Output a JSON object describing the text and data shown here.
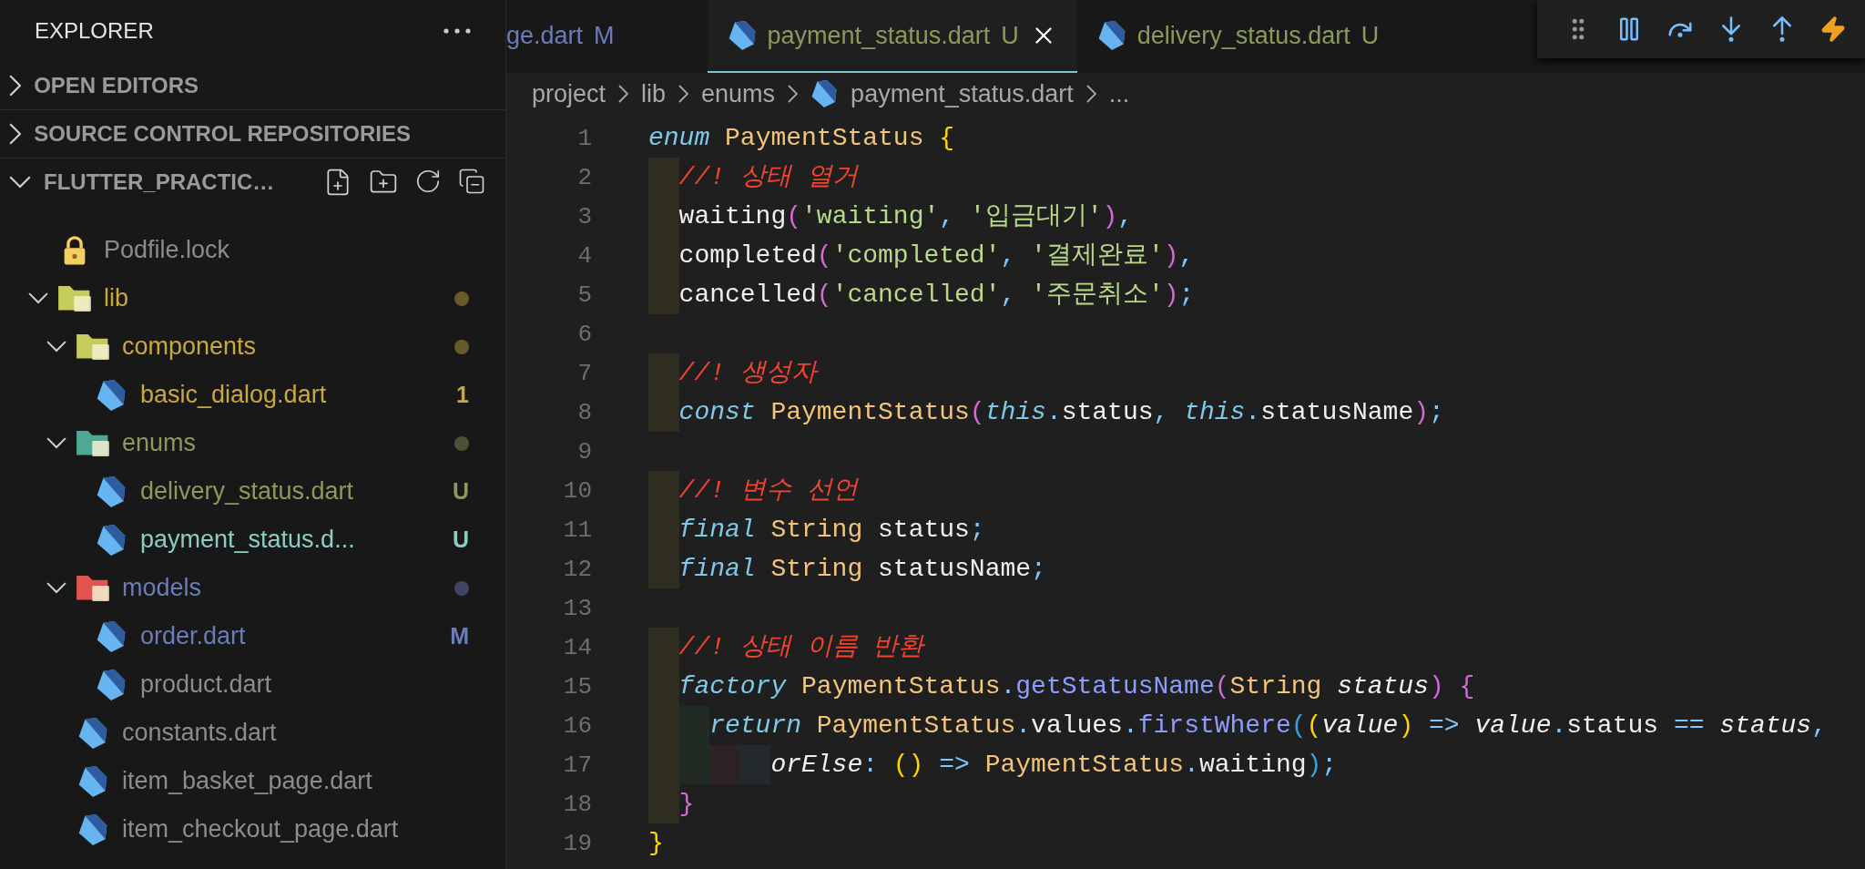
{
  "sidebar": {
    "title": "EXPLORER",
    "sections": [
      {
        "label": "OPEN EDITORS",
        "expanded": false
      },
      {
        "label": "SOURCE CONTROL REPOSITORIES",
        "expanded": false
      },
      {
        "label": "FLUTTER_PRACTIC…",
        "expanded": true,
        "tree": [
          {
            "label": "Podfile.lock",
            "kind": "lock",
            "color": "#8c8c8c"
          },
          {
            "label": "lib",
            "kind": "folder",
            "expanded": true,
            "color": "#c9a93b",
            "icon": {
              "color": "#c5cc5c"
            },
            "dot": true,
            "children": [
              {
                "label": "components",
                "kind": "folder",
                "expanded": true,
                "color": "#c9a93b",
                "icon": {
                  "color": "#c5cc5c"
                },
                "dot": true,
                "children": [
                  {
                    "label": "basic_dialog.dart",
                    "kind": "dart",
                    "color": "#c9a93b",
                    "badge": "1"
                  }
                ]
              },
              {
                "label": "enums",
                "kind": "folder",
                "expanded": true,
                "color": "#8a9a5b",
                "icon": {
                  "color": "#4fa894"
                },
                "dot": true,
                "children": [
                  {
                    "label": "delivery_status.dart",
                    "kind": "dart",
                    "color": "#8a9a5b",
                    "badge": "U"
                  },
                  {
                    "label": "payment_status.d...",
                    "kind": "dart",
                    "color": "#8ccdc3",
                    "badge": "U"
                  }
                ]
              },
              {
                "label": "models",
                "kind": "folder",
                "expanded": true,
                "color": "#6c7cb8",
                "icon": {
                  "color": "#e0534f"
                },
                "dot": true,
                "children": [
                  {
                    "label": "order.dart",
                    "kind": "dart",
                    "color": "#6c7cb8",
                    "badge": "M"
                  },
                  {
                    "label": "product.dart",
                    "kind": "dart",
                    "color": "#8c8c8c"
                  }
                ]
              },
              {
                "label": "constants.dart",
                "kind": "dart",
                "color": "#8c8c8c"
              },
              {
                "label": "item_basket_page.dart",
                "kind": "dart",
                "color": "#8c8c8c"
              },
              {
                "label": "item_checkout_page.dart",
                "kind": "dart",
                "color": "#8c8c8c"
              }
            ]
          }
        ]
      }
    ]
  },
  "tabs": [
    {
      "label": "ge.dart",
      "badge": "M",
      "color": "#6c7cb8",
      "selected": false
    },
    {
      "label": "payment_status.dart",
      "badge": "U",
      "color": "#8a9a5b",
      "selected": true
    },
    {
      "label": "delivery_status.dart",
      "badge": "U",
      "color": "#8a9a5b",
      "selected": false
    }
  ],
  "breadcrumb": [
    "project",
    "lib",
    "enums",
    "payment_status.dart",
    "..."
  ],
  "code": [
    {
      "n": "1",
      "tokens": [
        {
          "text": "enum",
          "kind": "kw"
        },
        {
          "text": " PaymentStatus ",
          "kind": "ty"
        },
        {
          "text": "{",
          "kind": "b1"
        }
      ],
      "children": [
        {
          "n": "2",
          "tokens": [
            {
              "text": "//! 상태 열거",
              "kind": "cm"
            }
          ]
        },
        {
          "n": "3",
          "tokens": [
            {
              "text": "waiting",
              "kind": "pl"
            },
            {
              "text": "(",
              "kind": "b2"
            },
            {
              "text": "'waiting'",
              "kind": "st"
            },
            {
              "text": ",",
              "kind": "pn"
            },
            {
              "text": " '입금대기'",
              "kind": "st"
            },
            {
              "text": ")",
              "kind": "b2"
            },
            {
              "text": ",",
              "kind": "pn"
            }
          ]
        },
        {
          "n": "4",
          "tokens": [
            {
              "text": "completed",
              "kind": "pl"
            },
            {
              "text": "(",
              "kind": "b2"
            },
            {
              "text": "'completed'",
              "kind": "st"
            },
            {
              "text": ",",
              "kind": "pn"
            },
            {
              "text": " '결제완료'",
              "kind": "st"
            },
            {
              "text": ")",
              "kind": "b2"
            },
            {
              "text": ",",
              "kind": "pn"
            }
          ]
        },
        {
          "n": "5",
          "tokens": [
            {
              "text": "cancelled",
              "kind": "pl"
            },
            {
              "text": "(",
              "kind": "b2"
            },
            {
              "text": "'cancelled'",
              "kind": "st"
            },
            {
              "text": ",",
              "kind": "pn"
            },
            {
              "text": " '주문취소'",
              "kind": "st"
            },
            {
              "text": ")",
              "kind": "b2"
            },
            {
              "text": ";",
              "kind": "pn"
            }
          ]
        },
        {
          "n": "6"
        },
        {
          "n": "7",
          "tokens": [
            {
              "text": "//! 생성자",
              "kind": "cm"
            }
          ]
        },
        {
          "n": "8",
          "tokens": [
            {
              "text": "const",
              "kind": "kw"
            },
            {
              "text": " PaymentStatus",
              "kind": "ty"
            },
            {
              "text": "(",
              "kind": "b2"
            },
            {
              "text": "this",
              "kind": "kw"
            },
            {
              "text": ".",
              "kind": "pn"
            },
            {
              "text": "status",
              "kind": "pl"
            },
            {
              "text": ",",
              "kind": "pn"
            },
            {
              "text": " this",
              "kind": "kw"
            },
            {
              "text": ".",
              "kind": "pn"
            },
            {
              "text": "statusName",
              "kind": "pl"
            },
            {
              "text": ")",
              "kind": "b2"
            },
            {
              "text": ";",
              "kind": "pn"
            }
          ]
        },
        {
          "n": "9"
        },
        {
          "n": "10",
          "tokens": [
            {
              "text": "//! 변수 선언",
              "kind": "cm"
            }
          ]
        },
        {
          "n": "11",
          "tokens": [
            {
              "text": "final",
              "kind": "kw"
            },
            {
              "text": " String",
              "kind": "ty"
            },
            {
              "text": " status",
              "kind": "pl"
            },
            {
              "text": ";",
              "kind": "pn"
            }
          ]
        },
        {
          "n": "12",
          "tokens": [
            {
              "text": "final",
              "kind": "kw"
            },
            {
              "text": " String",
              "kind": "ty"
            },
            {
              "text": " statusName",
              "kind": "pl"
            },
            {
              "text": ";",
              "kind": "pn"
            }
          ]
        },
        {
          "n": "13"
        },
        {
          "n": "14",
          "tokens": [
            {
              "text": "//! 상태 이름 반환",
              "kind": "cm"
            }
          ]
        },
        {
          "n": "15",
          "tokens": [
            {
              "text": "factory",
              "kind": "kw"
            },
            {
              "text": " PaymentStatus",
              "kind": "ty"
            },
            {
              "text": ".",
              "kind": "pn"
            },
            {
              "text": "getStatusName",
              "kind": "fn"
            },
            {
              "text": "(",
              "kind": "b2"
            },
            {
              "text": "String",
              "kind": "ty"
            },
            {
              "text": " status",
              "kind": "it"
            },
            {
              "text": ")",
              "kind": "b2"
            },
            {
              "text": " {",
              "kind": "b2"
            }
          ],
          "children": [
            {
              "n": "16",
              "tokens": [
                {
                  "text": "return",
                  "kind": "kw"
                },
                {
                  "text": " PaymentStatus",
                  "kind": "ty"
                },
                {
                  "text": ".",
                  "kind": "pn"
                },
                {
                  "text": "values",
                  "kind": "pl"
                },
                {
                  "text": ".",
                  "kind": "pn"
                },
                {
                  "text": "firstWhere",
                  "kind": "fn"
                },
                {
                  "text": "(",
                  "kind": "b3"
                },
                {
                  "text": "(",
                  "kind": "b1"
                },
                {
                  "text": "value",
                  "kind": "it"
                },
                {
                  "text": ")",
                  "kind": "b1"
                },
                {
                  "text": " =>",
                  "kind": "pn"
                },
                {
                  "text": " value",
                  "kind": "it"
                },
                {
                  "text": ".",
                  "kind": "pn"
                },
                {
                  "text": "status",
                  "kind": "pl"
                },
                {
                  "text": " ==",
                  "kind": "pn"
                },
                {
                  "text": " status",
                  "kind": "it"
                },
                {
                  "text": ",",
                  "kind": "pn"
                }
              ]
            },
            {
              "n": "17",
              "continuation": true,
              "tokens": [
                {
                  "text": "orElse",
                  "kind": "it"
                },
                {
                  "text": ":",
                  "kind": "pn"
                },
                {
                  "text": " ()",
                  "kind": "b1"
                },
                {
                  "text": " =>",
                  "kind": "pn"
                },
                {
                  "text": " PaymentStatus",
                  "kind": "ty"
                },
                {
                  "text": ".",
                  "kind": "pn"
                },
                {
                  "text": "waiting",
                  "kind": "pl"
                },
                {
                  "text": ")",
                  "kind": "b3"
                },
                {
                  "text": ";",
                  "kind": "pn"
                }
              ]
            }
          ]
        },
        {
          "n": "18",
          "tokens": [
            {
              "text": "}",
              "kind": "b2"
            }
          ]
        }
      ]
    },
    {
      "n": "19",
      "tokens": [
        {
          "text": "}",
          "kind": "b1"
        }
      ]
    }
  ]
}
